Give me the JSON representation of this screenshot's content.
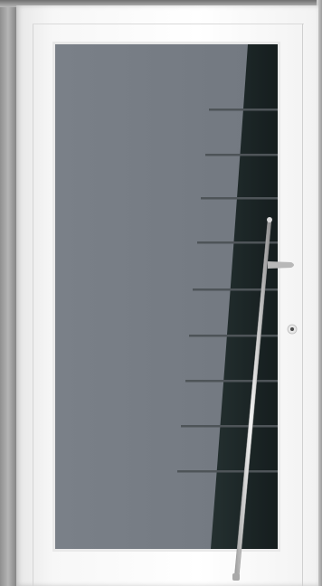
{
  "scene": {
    "subject": "door",
    "brand_label": "",
    "colors": {
      "frame": "#ffffff",
      "glass_grey": "#767c84",
      "glass_dark": "#1a2324",
      "handle": "#c9c9c9"
    },
    "lock_icon": "keyhole-icon"
  }
}
